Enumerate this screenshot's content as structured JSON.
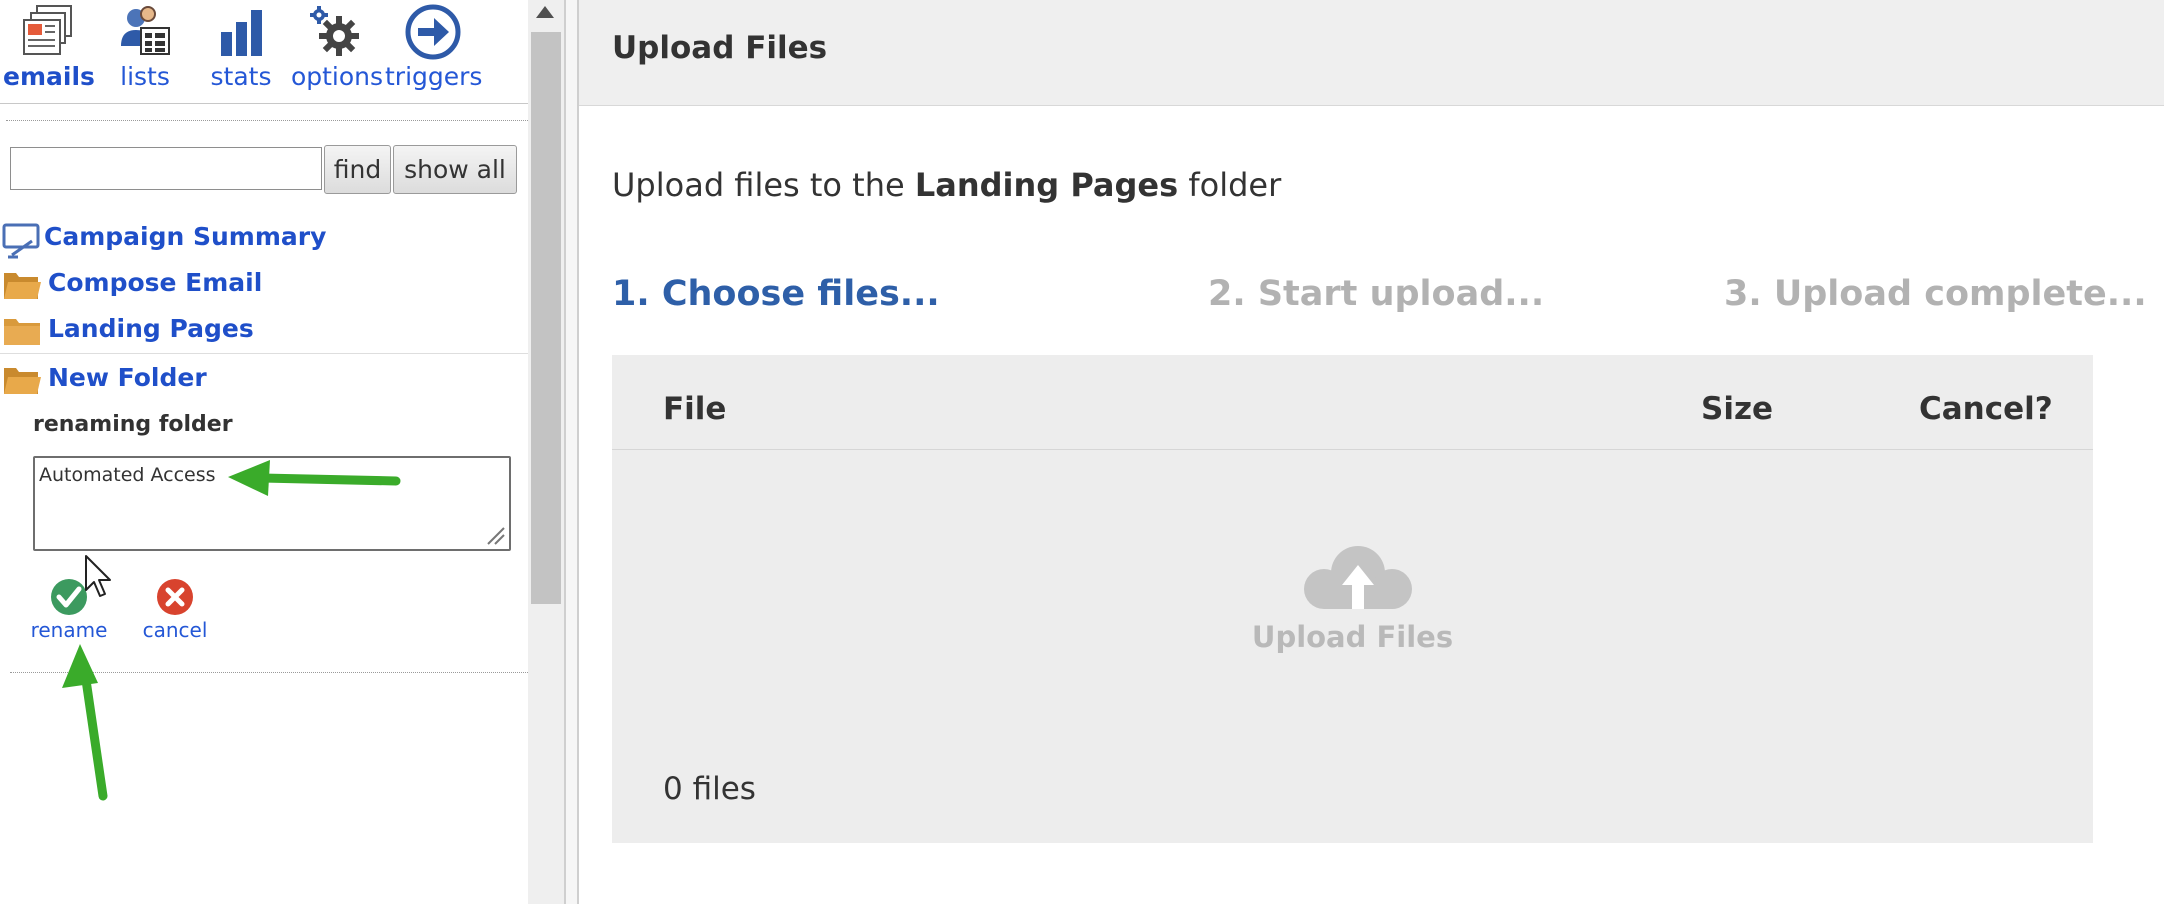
{
  "nav": [
    {
      "label": "emails",
      "icon": "emails-icon"
    },
    {
      "label": "lists",
      "icon": "lists-icon"
    },
    {
      "label": "stats",
      "icon": "stats-icon"
    },
    {
      "label": "options",
      "icon": "options-gear-icon"
    },
    {
      "label": "triggers",
      "icon": "triggers-arrow-icon"
    }
  ],
  "search": {
    "value": "",
    "placeholder": "",
    "find_label": "find",
    "show_all_label": "show all"
  },
  "tree": {
    "items": [
      {
        "label": "Campaign Summary",
        "icon": "campaign-summary-icon"
      },
      {
        "label": "Compose Email",
        "icon": "folder-open-icon"
      },
      {
        "label": "Landing Pages",
        "icon": "folder-icon"
      },
      {
        "label": "New Folder",
        "icon": "folder-open-icon"
      }
    ]
  },
  "rename": {
    "title": "renaming folder",
    "value": "Automated Access",
    "rename_label": "rename",
    "cancel_label": "cancel"
  },
  "main": {
    "header_title": "Upload Files",
    "intro_prefix": "Upload files to the",
    "intro_folder": "Landing Pages",
    "intro_suffix": "folder",
    "steps": [
      "1. Choose files...",
      "2. Start upload...",
      "3. Upload complete..."
    ],
    "columns": {
      "file": "File",
      "size": "Size",
      "cancel": "Cancel?"
    },
    "drop_label": "Upload Files",
    "file_count": "0 files"
  },
  "colors": {
    "link_blue": "#1f4fc9",
    "step_active": "#2e5fa8",
    "step_inactive": "#b2b2b2",
    "annotation_arrow": "#3aab2a",
    "confirm_green": "#3c9a5f",
    "cancel_red": "#d8432e"
  }
}
